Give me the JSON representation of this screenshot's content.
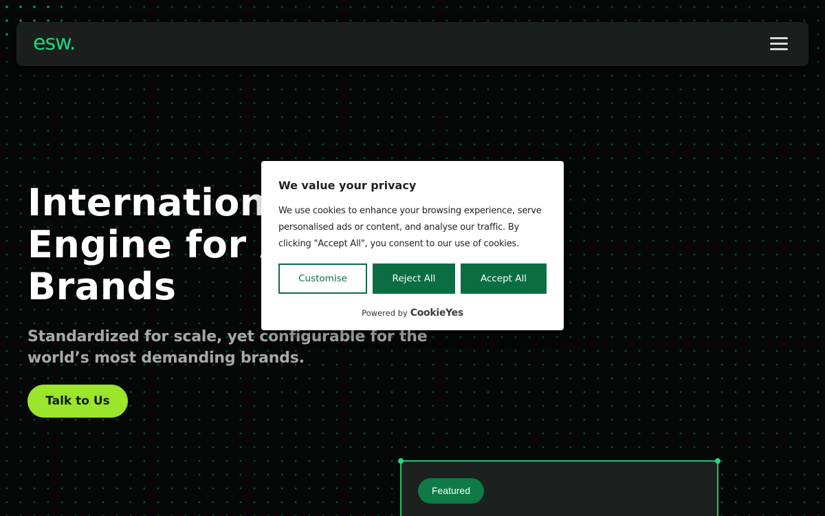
{
  "header": {
    "logo_text": "esw.",
    "menu_icon": "hamburger-menu-icon"
  },
  "hero": {
    "title_lines": [
      "International",
      "Engine for Ar",
      "Brands"
    ],
    "subtitle": "Standardized for scale, yet configurable for the world’s most demanding brands.",
    "cta_label": "Talk to Us"
  },
  "featured_card": {
    "badge_label": "Featured"
  },
  "cookie_banner": {
    "title": "We value your privacy",
    "body": "We use cookies to enhance your browsing experience, serve personalised ads or content, and analyse our traffic. By clicking \"Accept All\", you consent to our use of cookies.",
    "customise_label": "Customise",
    "reject_label": "Reject All",
    "accept_label": "Accept All",
    "powered_by": "Powered by",
    "powered_brand": "CookieYes"
  },
  "colors": {
    "accent_green": "#1fd37a",
    "cta_lime": "#9be52a",
    "cookie_button_green": "#0b6e43",
    "background": "#050807"
  }
}
